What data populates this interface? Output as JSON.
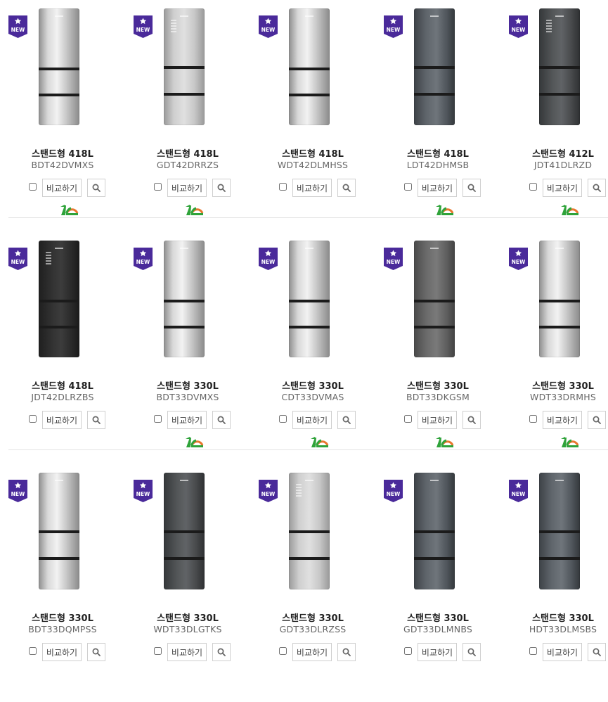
{
  "compare_label": "비교하기",
  "badge_text": "NEW",
  "search_icon": "magnifier-icon",
  "grade_icon": "energy-grade-1-icon",
  "colors": {
    "badge": "#4a2a9a",
    "grade_green": "#2fa33a",
    "grade_orange": "#e8772e"
  },
  "rows": [
    [
      {
        "title": "스탠드형 418L",
        "model": "BDT42DVMXS",
        "finish": "silver",
        "grade": true
      },
      {
        "title": "스탠드형 418L",
        "model": "GDT42DRRZS",
        "finish": "lightsilver",
        "grade": true
      },
      {
        "title": "스탠드형 418L",
        "model": "WDT42DLMHSS",
        "finish": "silver",
        "grade": false
      },
      {
        "title": "스탠드형 418L",
        "model": "LDT42DHMSB",
        "finish": "gray",
        "grade": true
      },
      {
        "title": "스탠드형 412L",
        "model": "JDT41DLRZD",
        "finish": "darkgray",
        "grade": true
      }
    ],
    [
      {
        "title": "스탠드형 418L",
        "model": "JDT42DLRZBS",
        "finish": "black",
        "grade": false
      },
      {
        "title": "스탠드형 330L",
        "model": "BDT33DVMXS",
        "finish": "silver",
        "grade": true
      },
      {
        "title": "스탠드형 330L",
        "model": "CDT33DVMAS",
        "finish": "silver",
        "grade": true
      },
      {
        "title": "스탠드형 330L",
        "model": "BDT33DKGSM",
        "finish": "graphite",
        "grade": true
      },
      {
        "title": "스탠드형 330L",
        "model": "WDT33DRMHS",
        "finish": "silver",
        "grade": true
      }
    ],
    [
      {
        "title": "스탠드형 330L",
        "model": "BDT33DQMPSS",
        "finish": "silver",
        "grade": false
      },
      {
        "title": "스탠드형 330L",
        "model": "WDT33DLGTKS",
        "finish": "darkgray",
        "grade": false
      },
      {
        "title": "스탠드형 330L",
        "model": "GDT33DLRZSS",
        "finish": "lightsilver",
        "grade": false
      },
      {
        "title": "스탠드형 330L",
        "model": "GDT33DLMNBS",
        "finish": "gray",
        "grade": false
      },
      {
        "title": "스탠드형 330L",
        "model": "HDT33DLMSBS",
        "finish": "gray",
        "grade": false
      }
    ]
  ]
}
